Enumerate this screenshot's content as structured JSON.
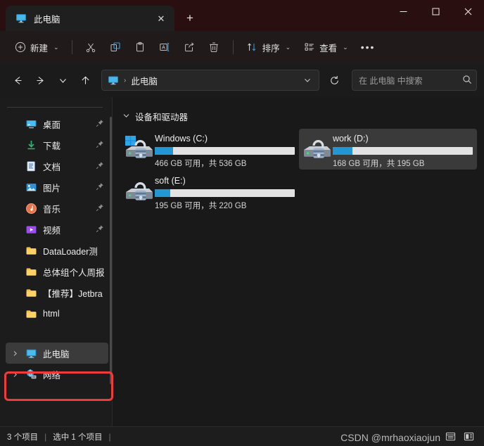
{
  "window": {
    "titlebar_color": "#2a0f10",
    "accent_color": "#2397d4",
    "annotation_color": "#f03b3b"
  },
  "tab": {
    "label": "此电脑",
    "icon": "monitor-icon",
    "close_label": "✕",
    "newtab_label": "+"
  },
  "window_controls": {
    "minimize": "minimize-icon",
    "maximize": "maximize-icon",
    "close": "close-icon"
  },
  "toolbar": {
    "new_label": "新建",
    "new_icon": "plus-circle-icon",
    "cut_icon": "scissors-icon",
    "copy_icon": "copy-icon",
    "paste_icon": "paste-icon",
    "rename_icon": "rename-icon",
    "share_icon": "share-icon",
    "delete_icon": "trash-icon",
    "sort_label": "排序",
    "sort_icon": "sort-arrows-icon",
    "view_label": "查看",
    "view_icon": "view-list-icon",
    "more_label": "•••",
    "chevron": "⌄"
  },
  "navbar": {
    "back_icon": "arrow-left-icon",
    "forward_icon": "arrow-right-icon",
    "recent_icon": "chevron-down-icon",
    "up_icon": "arrow-up-icon",
    "refresh_icon": "refresh-icon",
    "address": {
      "icon": "monitor-icon",
      "separator": "›",
      "path": "此电脑",
      "dropdown": "⌄"
    },
    "search": {
      "placeholder": "在 此电脑 中搜索",
      "icon": "search-icon"
    }
  },
  "sidebar": {
    "items": [
      {
        "label": "桌面",
        "icon": "desktop-icon",
        "pinned": true,
        "expander": false,
        "selected": false
      },
      {
        "label": "下载",
        "icon": "downloads-icon",
        "pinned": true,
        "expander": false,
        "selected": false
      },
      {
        "label": "文档",
        "icon": "documents-icon",
        "pinned": true,
        "expander": false,
        "selected": false
      },
      {
        "label": "图片",
        "icon": "pictures-icon",
        "pinned": true,
        "expander": false,
        "selected": false
      },
      {
        "label": "音乐",
        "icon": "music-icon",
        "pinned": true,
        "expander": false,
        "selected": false
      },
      {
        "label": "视频",
        "icon": "videos-icon",
        "pinned": true,
        "expander": false,
        "selected": false
      },
      {
        "label": "DataLoader测",
        "icon": "folder-icon",
        "pinned": false,
        "expander": false,
        "selected": false
      },
      {
        "label": "总体组个人周报",
        "icon": "folder-icon",
        "pinned": false,
        "expander": false,
        "selected": false
      },
      {
        "label": "【推荐】Jetbra",
        "icon": "folder-icon",
        "pinned": false,
        "expander": false,
        "selected": false
      },
      {
        "label": "html",
        "icon": "folder-icon",
        "pinned": false,
        "expander": false,
        "selected": false
      },
      {
        "label": "此电脑",
        "icon": "monitor-icon",
        "pinned": false,
        "expander": true,
        "selected": true
      },
      {
        "label": "网络",
        "icon": "network-icon",
        "pinned": false,
        "expander": true,
        "selected": false
      }
    ]
  },
  "main": {
    "group_title": "设备和驱动器",
    "group_chevron": "⌄",
    "drives": [
      {
        "name": "Windows (C:)",
        "icon": "drive-windows-locked-icon",
        "usage_text": "466 GB 可用，共 536 GB",
        "free_gb": 466,
        "total_gb": 536,
        "used_percent": 13,
        "selected": false
      },
      {
        "name": "work (D:)",
        "icon": "drive-locked-icon",
        "usage_text": "168 GB 可用，共 195 GB",
        "free_gb": 168,
        "total_gb": 195,
        "used_percent": 14,
        "selected": true
      },
      {
        "name": "soft (E:)",
        "icon": "drive-locked-icon",
        "usage_text": "195 GB 可用，共 220 GB",
        "free_gb": 195,
        "total_gb": 220,
        "used_percent": 11,
        "selected": false
      }
    ]
  },
  "statusbar": {
    "item_count": "3 个项目",
    "selection": "选中 1 个项目",
    "separator": "|",
    "details_view_icon": "details-view-icon",
    "large_icons_view_icon": "large-icons-view-icon"
  },
  "watermark": {
    "text": "CSDN @mrhaoxiaojun"
  }
}
